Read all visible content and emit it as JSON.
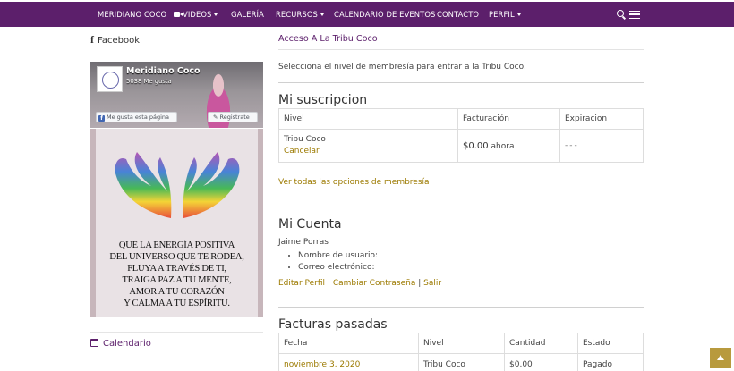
{
  "nav": {
    "items": [
      {
        "label": "MERIDIANO COCO"
      },
      {
        "label": "VIDEOS"
      },
      {
        "label": "GALERÍA"
      },
      {
        "label": "RECURSOS"
      },
      {
        "label": "CALENDARIO DE EVENTOS"
      },
      {
        "label": "CONTACTO"
      },
      {
        "label": "PERFIL"
      }
    ],
    "icons": [
      "video-camera-icon",
      "search-icon",
      "menu-icon"
    ],
    "color": "#5c1f6b"
  },
  "sidebar": {
    "facebook_title": "Facebook",
    "fb_widget": {
      "page_name": "Meridiano Coco",
      "likes": "5038 Me gusta",
      "like_button": "Me gusta esta página",
      "register_button": "Registrate"
    },
    "poster_text": [
      "QUE LA ENERGÍA POSITIVA",
      "DEL UNIVERSO QUE TE RODEA,",
      "FLUYA A TRAVÉS DE TI,",
      "TRAIGA PAZ A TU MENTE,",
      "AMOR A TU CORAZÓN",
      "Y CALMA A TU ESPÍRITU."
    ],
    "calendar_title": "Calendario"
  },
  "main": {
    "page_title": "Acceso A La Tribu Coco",
    "intro": "Selecciona el nivel de membresía para entrar a la Tribu Coco.",
    "subscription": {
      "title": "Mi suscripcion",
      "headers": [
        "Nivel",
        "Facturación",
        "Expiracion"
      ],
      "level": "Tribu Coco",
      "cancel": "Cancelar",
      "amount": "$0.00",
      "amount_suffix": "ahora",
      "expiration": "---"
    },
    "view_all_link": "Ver todas las opciones de membresía",
    "account": {
      "title": "Mi Cuenta",
      "name": "Jaime Porras",
      "username_label": "Nombre de usuario:",
      "email_label": "Correo electrónico:",
      "edit_profile": "Editar Perfil",
      "sep1": "|",
      "change_password": "Cambiar Contraseña",
      "sep2": "|",
      "logout": "Salir"
    },
    "invoices": {
      "title": "Facturas pasadas",
      "headers": [
        "Fecha",
        "Nivel",
        "Cantidad",
        "Estado"
      ],
      "rows": [
        {
          "date": "noviembre 3, 2020",
          "level": "Tribu Coco",
          "amount": "$0.00",
          "status": "Pagado"
        }
      ]
    }
  },
  "colors": {
    "accent": "#5c1f6b",
    "link": "#9c7a00",
    "scroll_button": "#b89a3d"
  }
}
